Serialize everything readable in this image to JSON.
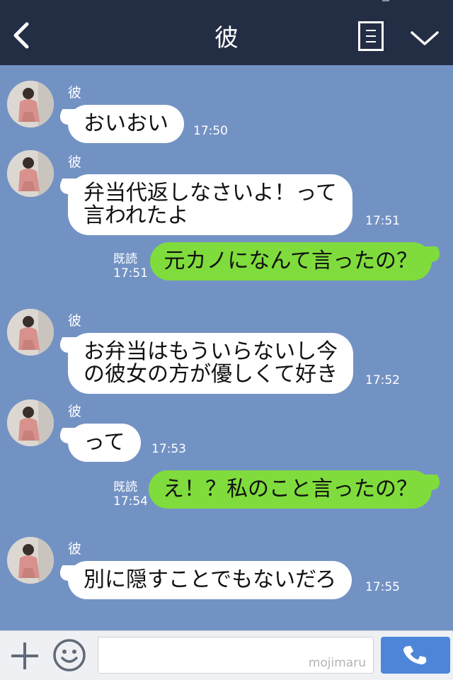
{
  "header": {
    "title": "彼",
    "back_icon": "chevron-left-icon",
    "menu_icon": "menu-list-icon",
    "dropdown_icon": "chevron-down-icon",
    "background": "#232d44"
  },
  "chat": {
    "background": "#7392c4",
    "incoming_bubble_color": "#ffffff",
    "outgoing_bubble_color": "#7fdc3c",
    "messages": [
      {
        "sender": "彼",
        "text": "おいおい",
        "time": "17:50"
      },
      {
        "sender": "彼",
        "text_lines": [
          "弁当代返しなさいよ！って",
          "言われたよ"
        ],
        "time": "17:51"
      },
      {
        "text": "元カノになんて言ったの？",
        "read": "既読",
        "time": "17:51"
      },
      {
        "sender": "彼",
        "text_lines": [
          "お弁当はもういらないし今",
          "の彼女の方が優しくて好き"
        ],
        "time": "17:52"
      },
      {
        "sender": "彼",
        "text": "って",
        "time": "17:53"
      },
      {
        "text": "え！？私のこと言ったの？",
        "read": "既読",
        "time": "17:54"
      },
      {
        "sender": "彼",
        "text": "別に隠すことでもないだろ",
        "time": "17:55"
      }
    ]
  },
  "inputbar": {
    "plus_icon": "plus-icon",
    "sticker_icon": "smiley-icon",
    "watermark": "mojimaru",
    "call_icon": "phone-icon",
    "call_color": "#4d86d9"
  }
}
